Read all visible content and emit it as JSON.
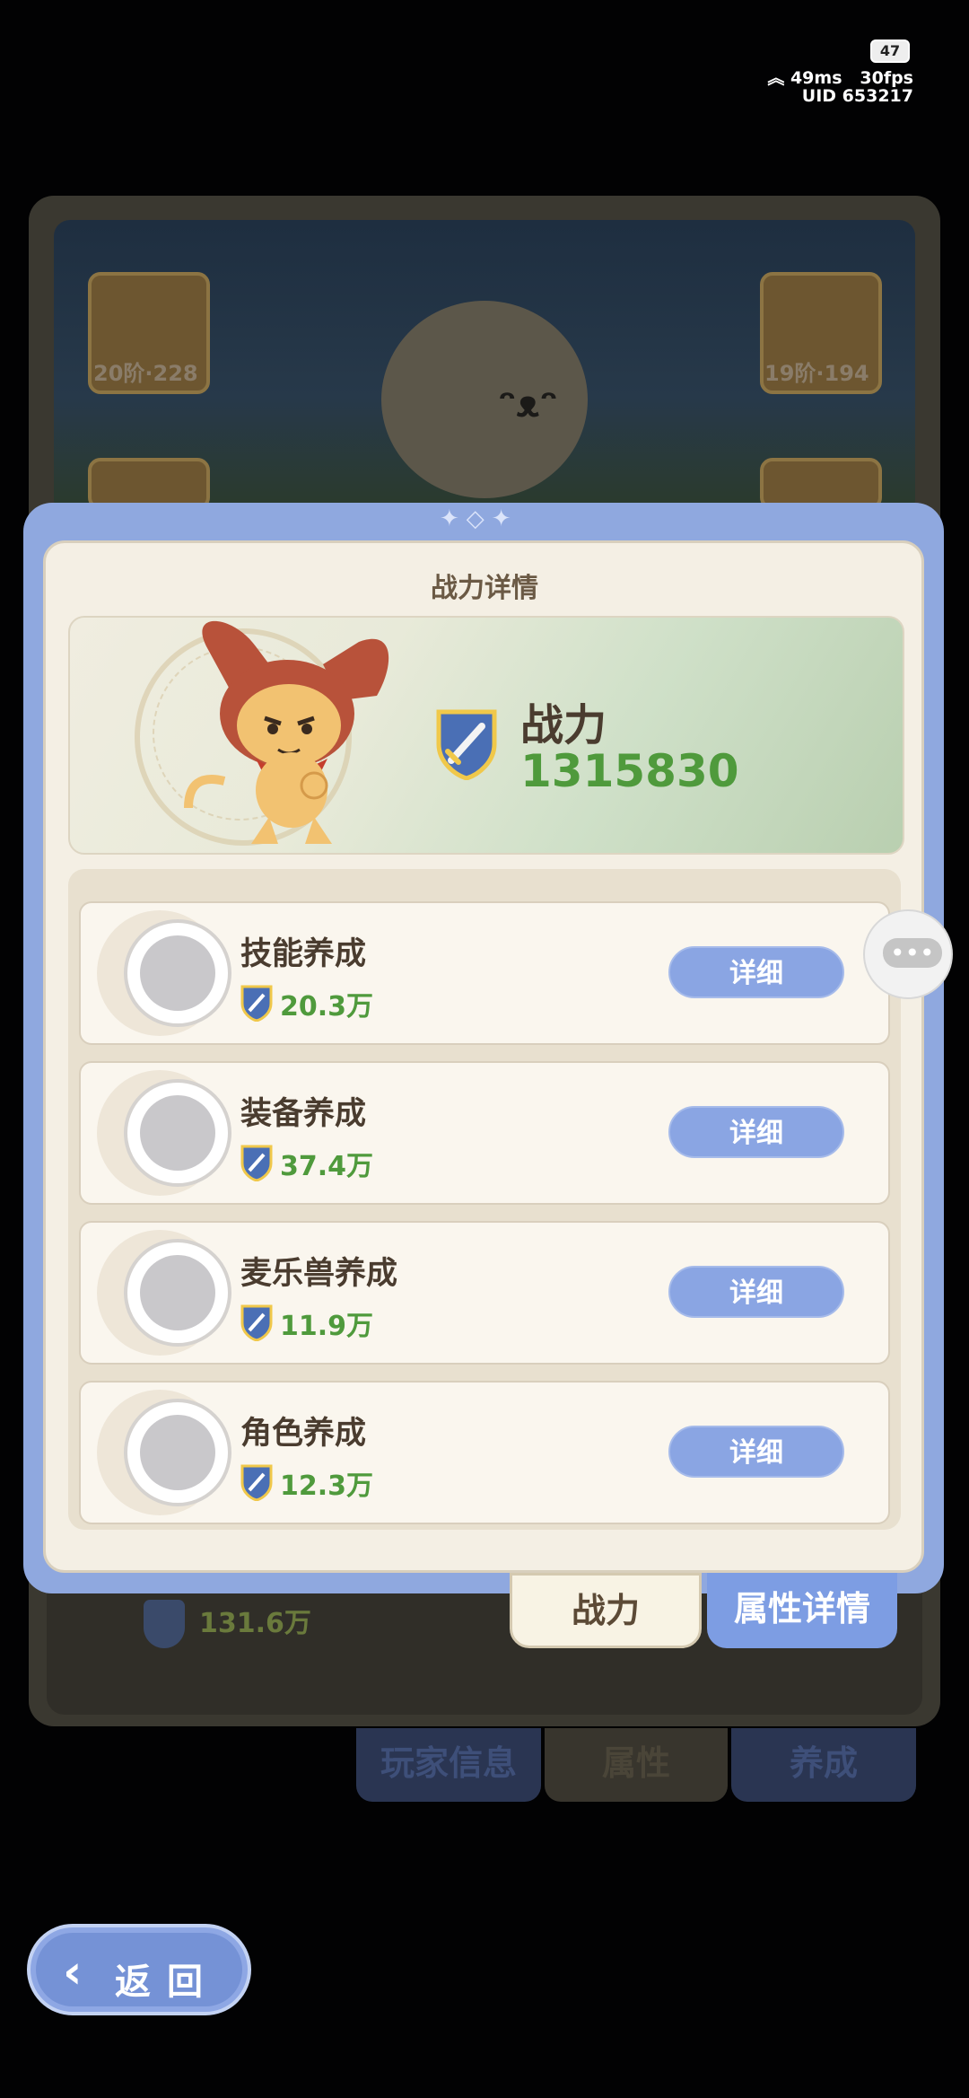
{
  "status": {
    "battery": "47",
    "ping": "49ms",
    "fps": "30fps",
    "uid": "UID 653217"
  },
  "background": {
    "heroes": [
      {
        "level": "20阶·228"
      },
      {
        "level": "19阶·194"
      }
    ],
    "total_power": "131.6万",
    "tabs": [
      "玩家信息",
      "属性",
      "养成"
    ]
  },
  "modal": {
    "title": "战力详情",
    "power_label": "战力",
    "power_value": "1315830",
    "rows": [
      {
        "title": "技能养成",
        "value": "20.3万",
        "button": "详细",
        "icon": "moon-star-icon"
      },
      {
        "title": "装备养成",
        "value": "37.4万",
        "button": "详细",
        "icon": "mask-sparkle-icon"
      },
      {
        "title": "麦乐兽养成",
        "value": "11.9万",
        "button": "详细",
        "icon": "cat-face-icon"
      },
      {
        "title": "角色养成",
        "value": "12.3万",
        "button": "详细",
        "icon": "character-head-icon"
      }
    ],
    "tabs": {
      "power": "战力",
      "attributes": "属性详情"
    }
  },
  "back_button": {
    "label": "返回"
  },
  "colors": {
    "accent_blue": "#8aa5e3",
    "power_green": "#4f9a3c",
    "frame": "#8fa8df"
  }
}
